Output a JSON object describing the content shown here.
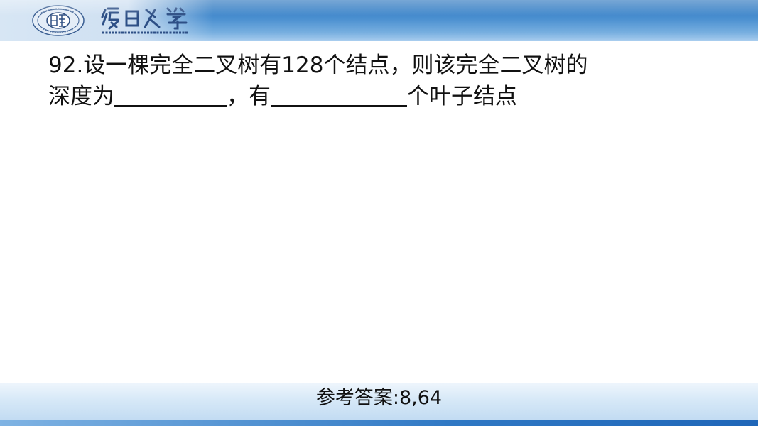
{
  "header": {
    "logo_label": "复旦大学",
    "brand_color": "#3a82c8"
  },
  "question": {
    "number": "92.",
    "line1_text": "设一棵完全二叉树有128个结点，则该完全二叉树的",
    "line2_part1": "深度为",
    "line2_part2": "，有",
    "line2_part3": "个叶子结点"
  },
  "answer": {
    "text": "参考答案:8,64"
  }
}
